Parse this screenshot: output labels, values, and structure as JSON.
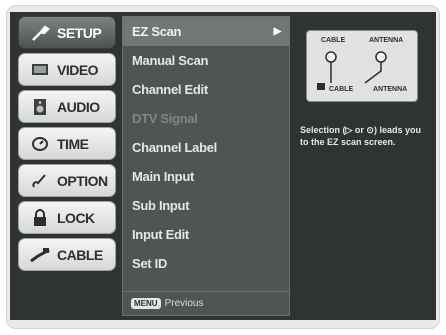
{
  "tabs": [
    {
      "label": "SETUP",
      "icon": "wrench-icon",
      "active": true
    },
    {
      "label": "VIDEO",
      "icon": "monitor-icon",
      "active": false
    },
    {
      "label": "AUDIO",
      "icon": "speaker-icon",
      "active": false
    },
    {
      "label": "TIME",
      "icon": "clock-icon",
      "active": false
    },
    {
      "label": "OPTION",
      "icon": "option-icon",
      "active": false
    },
    {
      "label": "LOCK",
      "icon": "lock-icon",
      "active": false
    },
    {
      "label": "CABLE",
      "icon": "cable-icon",
      "active": false
    }
  ],
  "menu": {
    "items": [
      {
        "label": "EZ Scan",
        "selected": true,
        "disabled": false
      },
      {
        "label": "Manual Scan",
        "selected": false,
        "disabled": false
      },
      {
        "label": "Channel Edit",
        "selected": false,
        "disabled": false
      },
      {
        "label": "DTV Signal",
        "selected": false,
        "disabled": true
      },
      {
        "label": "Channel Label",
        "selected": false,
        "disabled": false
      },
      {
        "label": "Main Input",
        "selected": false,
        "disabled": false
      },
      {
        "label": "Sub Input",
        "selected": false,
        "disabled": false
      },
      {
        "label": "Input Edit",
        "selected": false,
        "disabled": false
      },
      {
        "label": "Set ID",
        "selected": false,
        "disabled": false
      }
    ],
    "submenu_arrow": "▶",
    "footer_key": "MENU",
    "footer_label": "Previous"
  },
  "info": {
    "diagram": {
      "top_left_label": "CABLE",
      "top_right_label": "ANTENNA",
      "bottom_left_label": "CABLE",
      "bottom_right_label": "ANTENNA"
    },
    "text": "Selection (▷ or ⊙) leads you to the EZ scan screen."
  }
}
